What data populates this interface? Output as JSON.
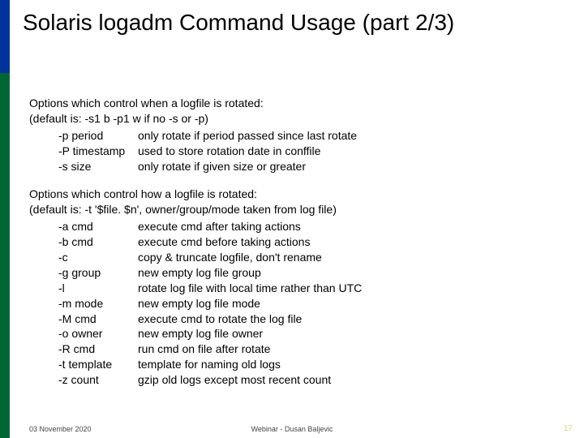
{
  "title": "Solaris logadm Command Usage (part 2/3)",
  "section1": {
    "heading": "Options which control when a logfile is rotated:",
    "default": "(default is: -s1 b -p1 w if no -s or -p)",
    "opts": [
      {
        "flag": "-p period",
        "desc": "only rotate if period passed since last rotate"
      },
      {
        "flag": "-P timestamp",
        "desc": "used to store rotation date in conffile"
      },
      {
        "flag": "-s size",
        "desc": "only rotate if given size or greater"
      }
    ]
  },
  "section2": {
    "heading": "Options which control how a logfile is rotated:",
    "default": "(default is: -t '$file. $n', owner/group/mode taken from log file)",
    "opts": [
      {
        "flag": "-a cmd",
        "desc": "execute cmd after taking actions"
      },
      {
        "flag": "-b cmd",
        "desc": "execute cmd before taking actions"
      },
      {
        "flag": "-c",
        "desc": "copy & truncate logfile, don't rename"
      },
      {
        "flag": "-g group",
        "desc": "new empty log file group"
      },
      {
        "flag": "-l",
        "desc": "rotate log file with local time rather than UTC"
      },
      {
        "flag": "-m mode",
        "desc": "new empty log file mode"
      },
      {
        "flag": "-M cmd",
        "desc": "execute cmd to rotate the log file"
      },
      {
        "flag": "-o owner",
        "desc": "new empty log file owner"
      },
      {
        "flag": "-R cmd",
        "desc": "run cmd on file after rotate"
      },
      {
        "flag": "-t template",
        "desc": "template for naming old logs"
      },
      {
        "flag": "-z count",
        "desc": "gzip old logs except most recent count"
      }
    ]
  },
  "footer": {
    "date": "03 November 2020",
    "center": "Webinar - Dusan Baljevic",
    "page": "17"
  }
}
